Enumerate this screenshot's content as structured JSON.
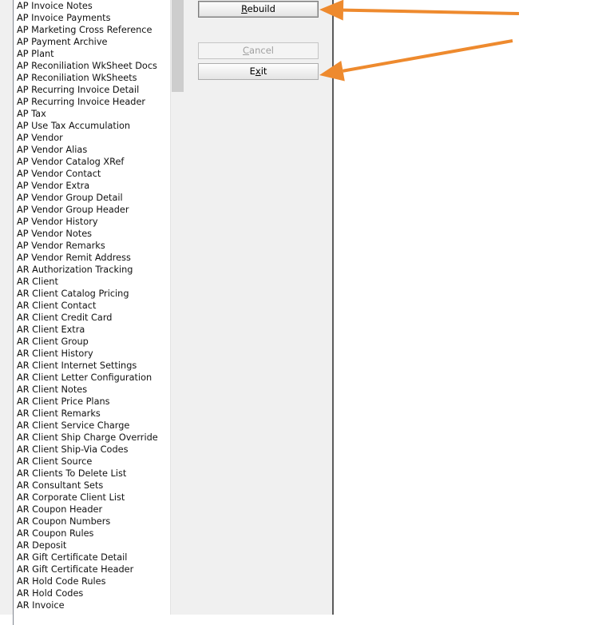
{
  "table_list": {
    "items": [
      "AP Invoice Notes",
      "AP Invoice Payments",
      "AP Marketing Cross Reference",
      "AP Payment Archive",
      "AP Plant",
      "AP Reconiliation WkSheet Docs",
      "AP Reconiliation WkSheets",
      "AP Recurring Invoice Detail",
      "AP Recurring Invoice Header",
      "AP Tax",
      "AP Use Tax Accumulation",
      "AP Vendor",
      "AP Vendor Alias",
      "AP Vendor Catalog XRef",
      "AP Vendor Contact",
      "AP Vendor Extra",
      "AP Vendor Group Detail",
      "AP Vendor Group Header",
      "AP Vendor History",
      "AP Vendor Notes",
      "AP Vendor Remarks",
      "AP Vendor Remit Address",
      "AR Authorization Tracking",
      "AR Client",
      "AR Client Catalog Pricing",
      "AR Client Contact",
      "AR Client Credit Card",
      "AR Client Extra",
      "AR Client Group",
      "AR Client History",
      "AR Client Internet Settings",
      "AR Client Letter Configuration",
      "AR Client Notes",
      "AR Client Price Plans",
      "AR Client Remarks",
      "AR Client Service Charge",
      "AR Client Ship Charge Override",
      "AR Client Ship-Via Codes",
      "AR Client Source",
      "AR Clients To Delete List",
      "AR Consultant Sets",
      "AR Corporate Client List",
      "AR Coupon Header",
      "AR Coupon Numbers",
      "AR Coupon Rules",
      "AR Deposit",
      "AR Gift Certificate Detail",
      "AR Gift Certificate Header",
      "AR Hold Code Rules",
      "AR Hold Codes",
      "AR Invoice"
    ]
  },
  "buttons": {
    "rebuild": {
      "accel": "R",
      "rest": "ebuild"
    },
    "cancel": {
      "accel": "C",
      "rest": "ancel"
    },
    "exit": {
      "pre": "E",
      "accel": "x",
      "rest": "it"
    }
  },
  "colors": {
    "annotation_arrow": "#ee8a2e",
    "dialog_bg": "#f0f0f0",
    "list_bg": "#ffffff"
  }
}
